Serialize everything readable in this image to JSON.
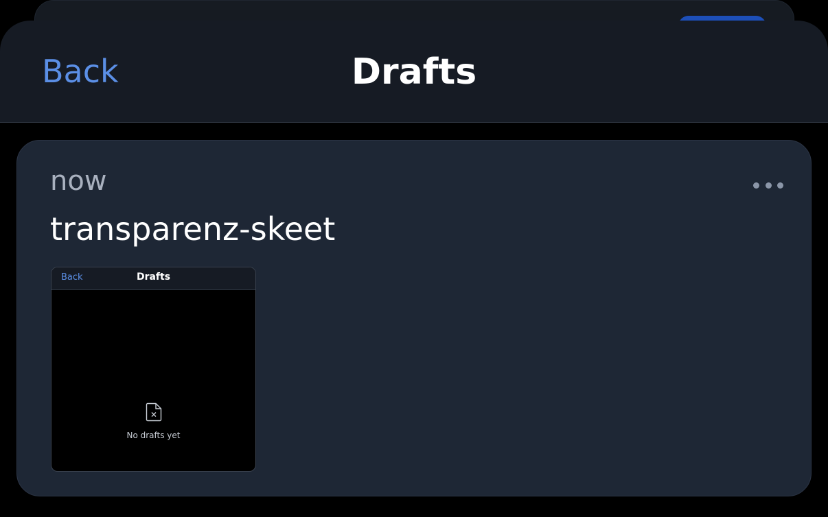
{
  "header": {
    "back_label": "Back",
    "title": "Drafts"
  },
  "draft": {
    "time": "now",
    "title": "transparenz-skeet",
    "more_icon": "ellipsis-icon",
    "preview": {
      "back_label": "Back",
      "title": "Drafts",
      "empty_icon": "file-x-icon",
      "empty_text": "No drafts yet"
    }
  },
  "colors": {
    "accent": "#5b8fe6",
    "card_bg": "#1e2735",
    "header_bg": "#161b24",
    "page_bg": "#000000"
  }
}
